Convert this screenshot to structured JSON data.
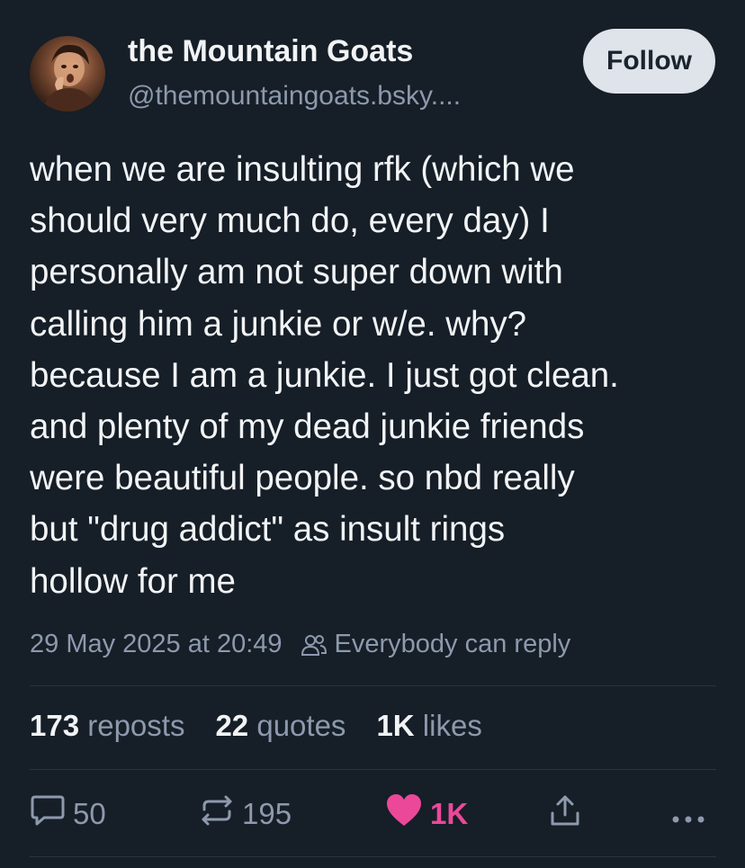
{
  "author": {
    "display_name": "the Mountain Goats",
    "handle": "@themountaingoats.bsky....",
    "follow_label": "Follow"
  },
  "post": {
    "lines": [
      "when we are insulting rfk (which we",
      "should very much do, every day) I",
      "personally am not super down with",
      "calling him a junkie or w/e. why?",
      "because I am a junkie. I just got clean.",
      "and plenty of my dead junkie friends",
      "were beautiful people. so nbd really",
      "but \"drug addict\" as insult rings",
      "hollow for me"
    ],
    "timestamp": "29 May 2025 at 20:49",
    "reply_setting": "Everybody can reply"
  },
  "stats": {
    "reposts_count": "173",
    "reposts_label": "reposts",
    "quotes_count": "22",
    "quotes_label": "quotes",
    "likes_count": "1K",
    "likes_label": "likes"
  },
  "actions": {
    "reply_count": "50",
    "repost_count": "195",
    "like_count": "1K",
    "reply_icon": "speech-bubble-icon",
    "repost_icon": "repost-arrows-icon",
    "like_icon": "heart-icon",
    "share_icon": "share-icon",
    "more_icon": "more-dots-icon"
  },
  "colors": {
    "background": "#161e27",
    "text": "#f1f3f5",
    "muted": "#8d99ad",
    "like_pink": "#ec4899",
    "follow_button": "#dfe4ea"
  }
}
